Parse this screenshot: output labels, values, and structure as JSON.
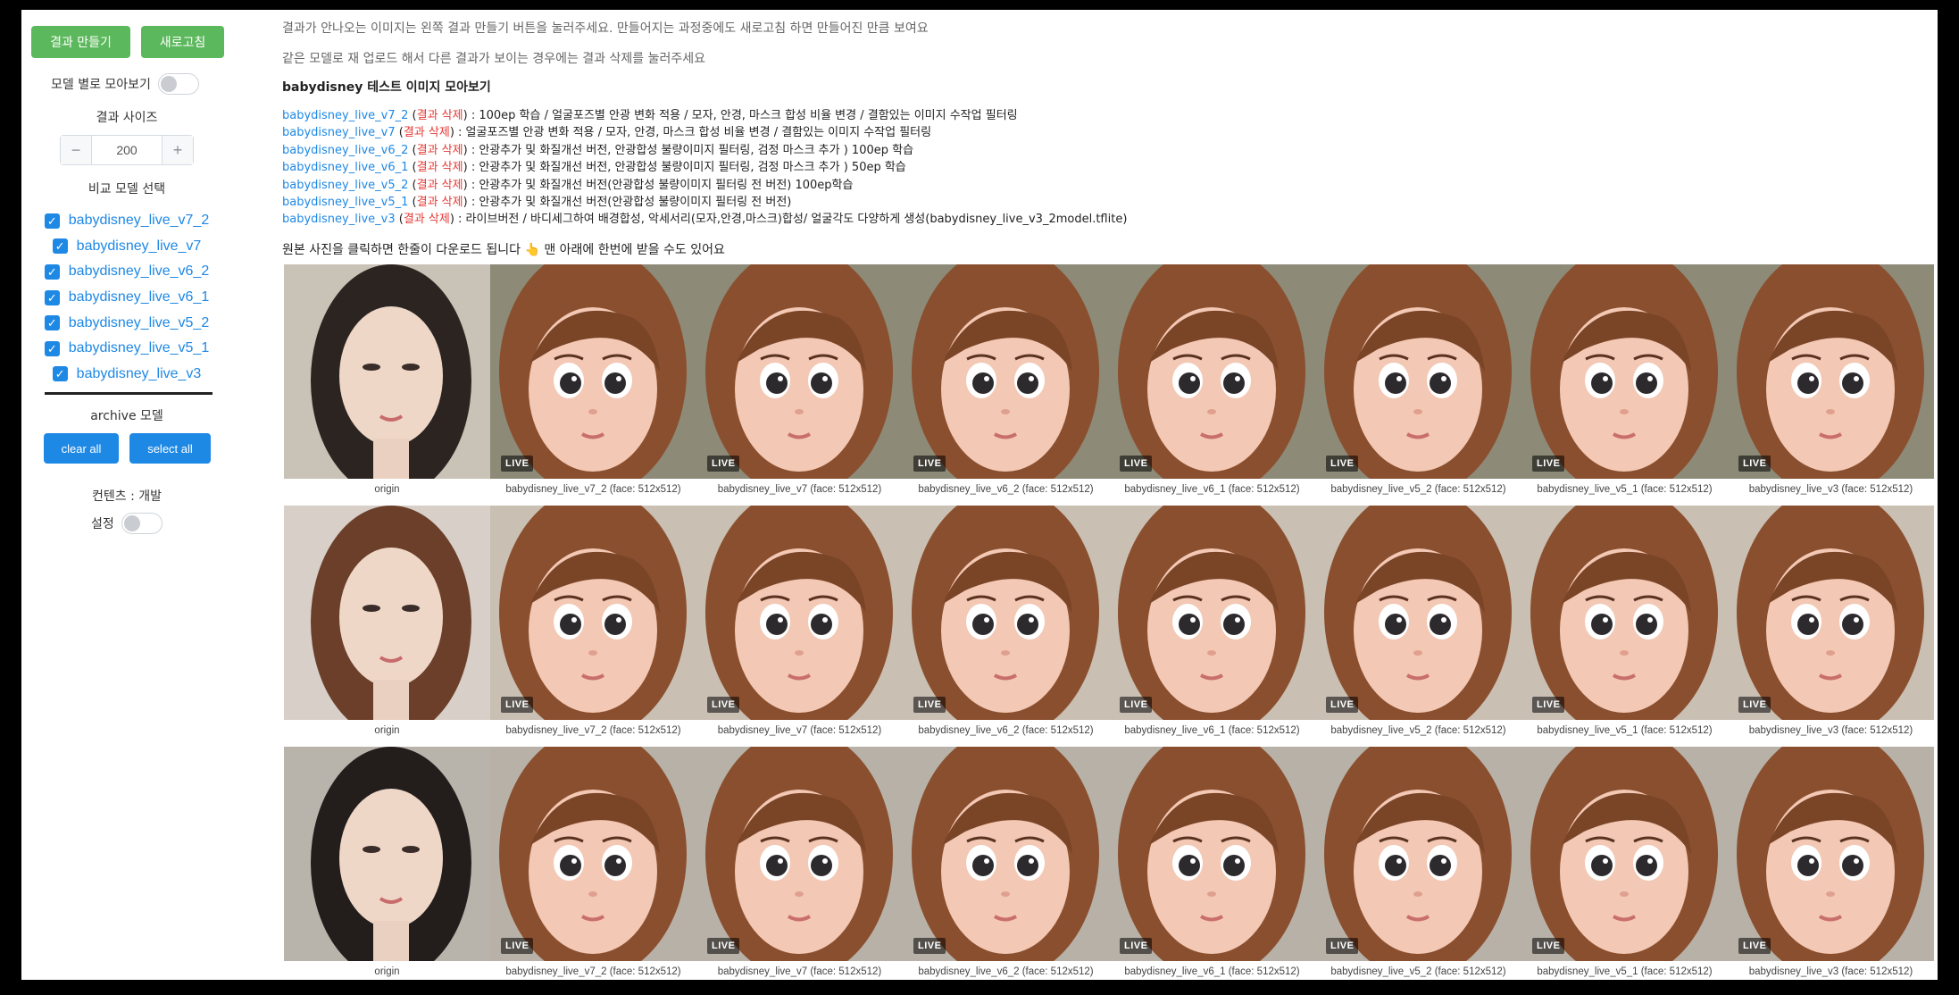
{
  "sidebar": {
    "make_button": "결과 만들기",
    "refresh_button": "새로고침",
    "group_by_model_label": "모델 별로 모아보기",
    "result_size_label": "결과 사이즈",
    "size_minus": "−",
    "size_value": "200",
    "size_plus": "+",
    "compare_models_label": "비교 모델 선택",
    "models": [
      {
        "label": "babydisney_live_v7_2",
        "checked": true
      },
      {
        "label": "babydisney_live_v7",
        "checked": true
      },
      {
        "label": "babydisney_live_v6_2",
        "checked": true
      },
      {
        "label": "babydisney_live_v6_1",
        "checked": true
      },
      {
        "label": "babydisney_live_v5_2",
        "checked": true
      },
      {
        "label": "babydisney_live_v5_1",
        "checked": true
      },
      {
        "label": "babydisney_live_v3",
        "checked": true
      }
    ],
    "archive_label": "archive 모델",
    "clear_all": "clear all",
    "select_all": "select all",
    "contents_label": "컨텐츠 : 개발",
    "settings_label": "설정"
  },
  "main": {
    "notice1": "결과가 안나오는 이미지는 왼쪽 결과 만들기 버튼을 눌러주세요. 만들어지는 과정중에도 새로고침 하면 만들어진 만큼 보여요",
    "notice2": "같은 모델로 재 업로드 해서 다른 결과가 보이는 경우에는 결과 삭제를 눌러주세요",
    "heading": "babydisney 테스트 이미지 모아보기",
    "delete_label": "결과 삭제",
    "descriptions": [
      {
        "model": "babydisney_live_v7_2",
        "text": ": 100ep 학습 / 얼굴포즈별 안광 변화 적용 / 모자, 안경, 마스크 합성 비율 변경 / 결함있는 이미지 수작업 필터링"
      },
      {
        "model": "babydisney_live_v7",
        "text": ": 얼굴포즈별 안광 변화 적용 / 모자, 안경, 마스크 합성 비율 변경 / 결함있는 이미지 수작업 필터링"
      },
      {
        "model": "babydisney_live_v6_2",
        "text": ": 안광추가 및 화질개선 버전, 안광합성 불량이미지 필터링, 검정 마스크 추가 ) 100ep 학습"
      },
      {
        "model": "babydisney_live_v6_1",
        "text": ": 안광추가 및 화질개선 버전, 안광합성 불량이미지 필터링, 검정 마스크 추가 ) 50ep 학습"
      },
      {
        "model": "babydisney_live_v5_2",
        "text": ": 안광추가 및 화질개선 버전(안광합성 불량이미지 필터링 전 버전) 100ep학습"
      },
      {
        "model": "babydisney_live_v5_1",
        "text": ": 안광추가 및 화질개선 버전(안광합성 불량이미지 필터링 전 버전)"
      },
      {
        "model": "babydisney_live_v3",
        "text": ": 라이브버전 / 바디세그하여 배경합성, 악세서리(모자,안경,마스크)합성/ 얼굴각도 다양하게 생성(babydisney_live_v3_2model.tflite)"
      }
    ],
    "download_note": "원본 사진을 클릭하면 한줄이 다운로드 됩니다",
    "download_note_tail": "맨 아래에 한번에 받을 수도 있어요",
    "hand_icon": "👆"
  },
  "grid": {
    "live_badge": "LIVE",
    "rows": [
      {
        "captions": [
          "origin",
          "babydisney_live_v7_2 (face: 512x512)",
          "babydisney_live_v7 (face: 512x512)",
          "babydisney_live_v6_2 (face: 512x512)",
          "babydisney_live_v6_1 (face: 512x512)",
          "babydisney_live_v5_2 (face: 512x512)",
          "babydisney_live_v5_1 (face: 512x512)",
          "babydisney_live_v3 (face: 512x512)"
        ]
      },
      {
        "captions": [
          "origin",
          "babydisney_live_v7_2 (face: 512x512)",
          "babydisney_live_v7 (face: 512x512)",
          "babydisney_live_v6_2 (face: 512x512)",
          "babydisney_live_v6_1 (face: 512x512)",
          "babydisney_live_v5_2 (face: 512x512)",
          "babydisney_live_v5_1 (face: 512x512)",
          "babydisney_live_v3 (face: 512x512)"
        ]
      },
      {
        "captions": [
          "origin",
          "babydisney_live_v7_2 (face: 512x512)",
          "babydisney_live_v7 (face: 512x512)",
          "babydisney_live_v6_2 (face: 512x512)",
          "babydisney_live_v6_1 (face: 512x512)",
          "babydisney_live_v5_2 (face: 512x512)",
          "babydisney_live_v5_1 (face: 512x512)",
          "babydisney_live_v3 (face: 512x512)"
        ]
      }
    ]
  },
  "colors": {
    "green_button": "#5cb85c",
    "blue_accent": "#1e88e5",
    "delete_red": "#e53935"
  }
}
